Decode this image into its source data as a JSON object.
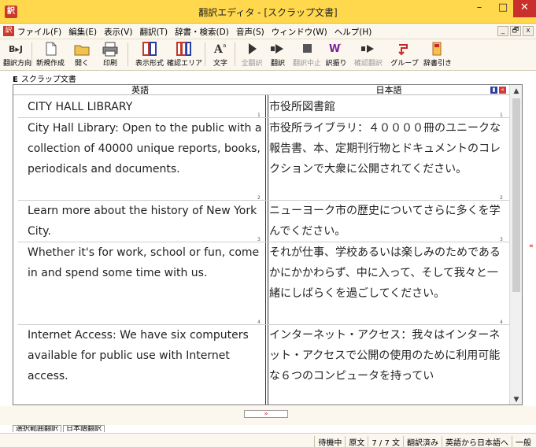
{
  "window": {
    "title": "翻訳エディタ - [スクラップ文書]",
    "app_icon": "訳",
    "minimize": "–",
    "maximize": "□",
    "close": "✕"
  },
  "menu": {
    "items": [
      "ファイル(F)",
      "編集(E)",
      "表示(V)",
      "翻訳(T)",
      "辞書・検索(D)",
      "音声(S)",
      "ウィンドウ(W)",
      "ヘルプ(H)"
    ],
    "window_controls": [
      "_",
      "🗗",
      "x"
    ]
  },
  "toolbar": {
    "buttons": [
      {
        "label": "翻訳方向",
        "icon": "translation-direction-icon",
        "enabled": true
      },
      {
        "label": "新規作成",
        "icon": "new-document-icon",
        "enabled": true
      },
      {
        "label": "開く",
        "icon": "open-folder-icon",
        "enabled": true
      },
      {
        "label": "印刷",
        "icon": "printer-icon",
        "enabled": true
      },
      {
        "label": "表示形式",
        "icon": "layout-icon",
        "enabled": true
      },
      {
        "label": "確認エリア",
        "icon": "check-area-icon",
        "enabled": true
      },
      {
        "label": "文字",
        "icon": "font-icon",
        "enabled": true
      },
      {
        "label": "全翻訳",
        "icon": "translate-all-icon",
        "enabled": false
      },
      {
        "label": "翻訳",
        "icon": "translate-icon",
        "enabled": true
      },
      {
        "label": "翻訳中止",
        "icon": "stop-icon",
        "enabled": false
      },
      {
        "label": "訳振り",
        "icon": "annotate-icon",
        "enabled": true
      },
      {
        "label": "確認翻訳",
        "icon": "verify-translate-icon",
        "enabled": false
      },
      {
        "label": "グループ",
        "icon": "group-icon",
        "enabled": true
      },
      {
        "label": "辞書引き",
        "icon": "dictionary-icon",
        "enabled": true
      }
    ],
    "direction_badge": "B▸J"
  },
  "doc_tab": {
    "marker": "E",
    "label": "スクラップ文書"
  },
  "editor": {
    "header_left": "英語",
    "header_right": "日本語",
    "segments": [
      {
        "num": "1",
        "en": "CITY HALL LIBRARY",
        "ja": "市役所図書館"
      },
      {
        "num": "2",
        "en": "City Hall Library: Open to the public with a collection of 40000 unique reports, books, periodicals and documents.",
        "ja": "市役所ライブラリ：４００００冊のユニークな報告書、本、定期刊行物とドキュメントのコレクションで大衆に公開されてください。"
      },
      {
        "num": "3",
        "en": "Learn more about the history of New York City.",
        "ja": "ニューヨーク市の歴史についてさらに多くを学んでください。"
      },
      {
        "num": "4",
        "en": "Whether it's for work, school or fun, come in and spend some time with us.",
        "ja": "それが仕事、学校あるいは楽しみのためであるかにかかわらず、中に入って、そして我々と一緒にしばらくを過ごしてください。"
      },
      {
        "num": "",
        "en": "Internet Access: We have six computers available for public use with Internet access.",
        "ja": "インターネット・アクセス：我々はインターネット・アクセスで公開の使用のために利用可能な６つのコンピュータを持ってい"
      }
    ]
  },
  "lower_tabs": [
    "選択範囲翻訳",
    "日本語翻訳"
  ],
  "status": {
    "cells": [
      "待機中",
      "原文",
      "7 / 7 文",
      "翻訳済み",
      "英語から日本語へ",
      "一般"
    ]
  },
  "colors": {
    "title_bar": "#ffd84d",
    "accent_red": "#c62828",
    "menu_bg": "#fbf7ee"
  }
}
